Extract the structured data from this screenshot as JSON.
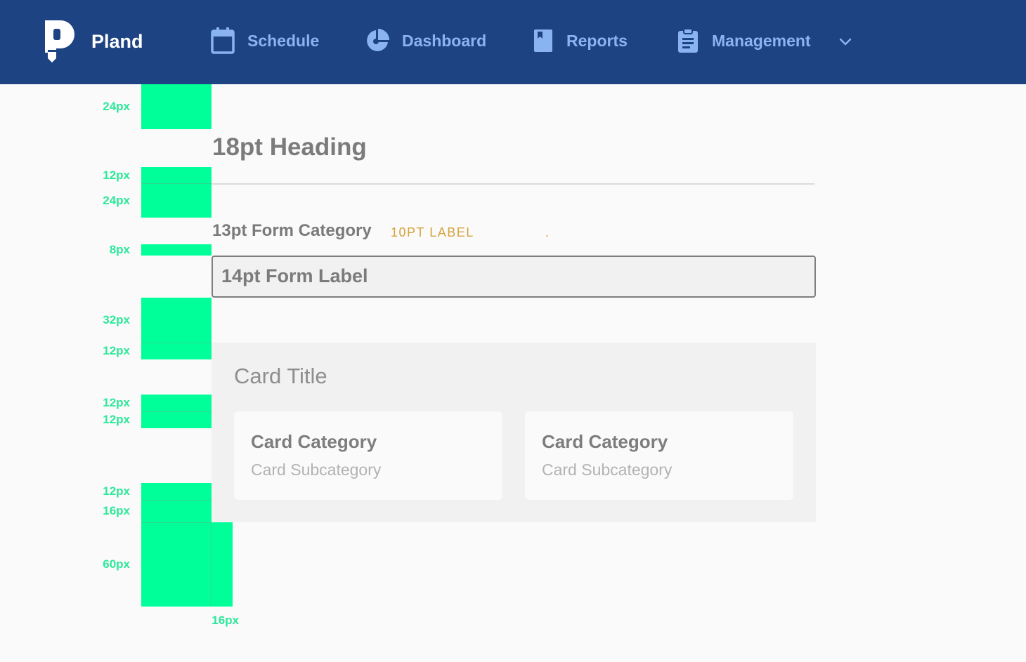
{
  "app": {
    "brand": "Pland",
    "logo_icon": "pland-logo-icon"
  },
  "nav": {
    "items": [
      {
        "label": "Schedule",
        "icon": "calendar-icon"
      },
      {
        "label": "Dashboard",
        "icon": "pie-chart-icon"
      },
      {
        "label": "Reports",
        "icon": "book-icon"
      },
      {
        "label": "Management",
        "icon": "clipboard-icon"
      }
    ],
    "dropdown_icon": "chevron-down-icon"
  },
  "colors": {
    "nav_bg": "#1e4382",
    "nav_text": "#8ab4f0",
    "guide": "#00ff99",
    "guide_label": "#2ee89a",
    "label_accent": "#d4a23a",
    "page_bg": "#fafafa",
    "card_bg": "#f1f1f1"
  },
  "spacing": {
    "labels": [
      "24px",
      "12px",
      "24px",
      "8px",
      "32px",
      "12px",
      "12px",
      "12px",
      "12px",
      "16px",
      "60px",
      "16px"
    ]
  },
  "content": {
    "heading": "18pt Heading",
    "form_category": "13pt Form Category",
    "small_label": "10PT LABEL",
    "small_dot": ".",
    "input_value": "14pt Form Label",
    "card": {
      "title": "Card Title",
      "items": [
        {
          "category": "Card Category",
          "subcategory": "Card Subcategory"
        },
        {
          "category": "Card Category",
          "subcategory": "Card Subcategory"
        }
      ]
    }
  }
}
